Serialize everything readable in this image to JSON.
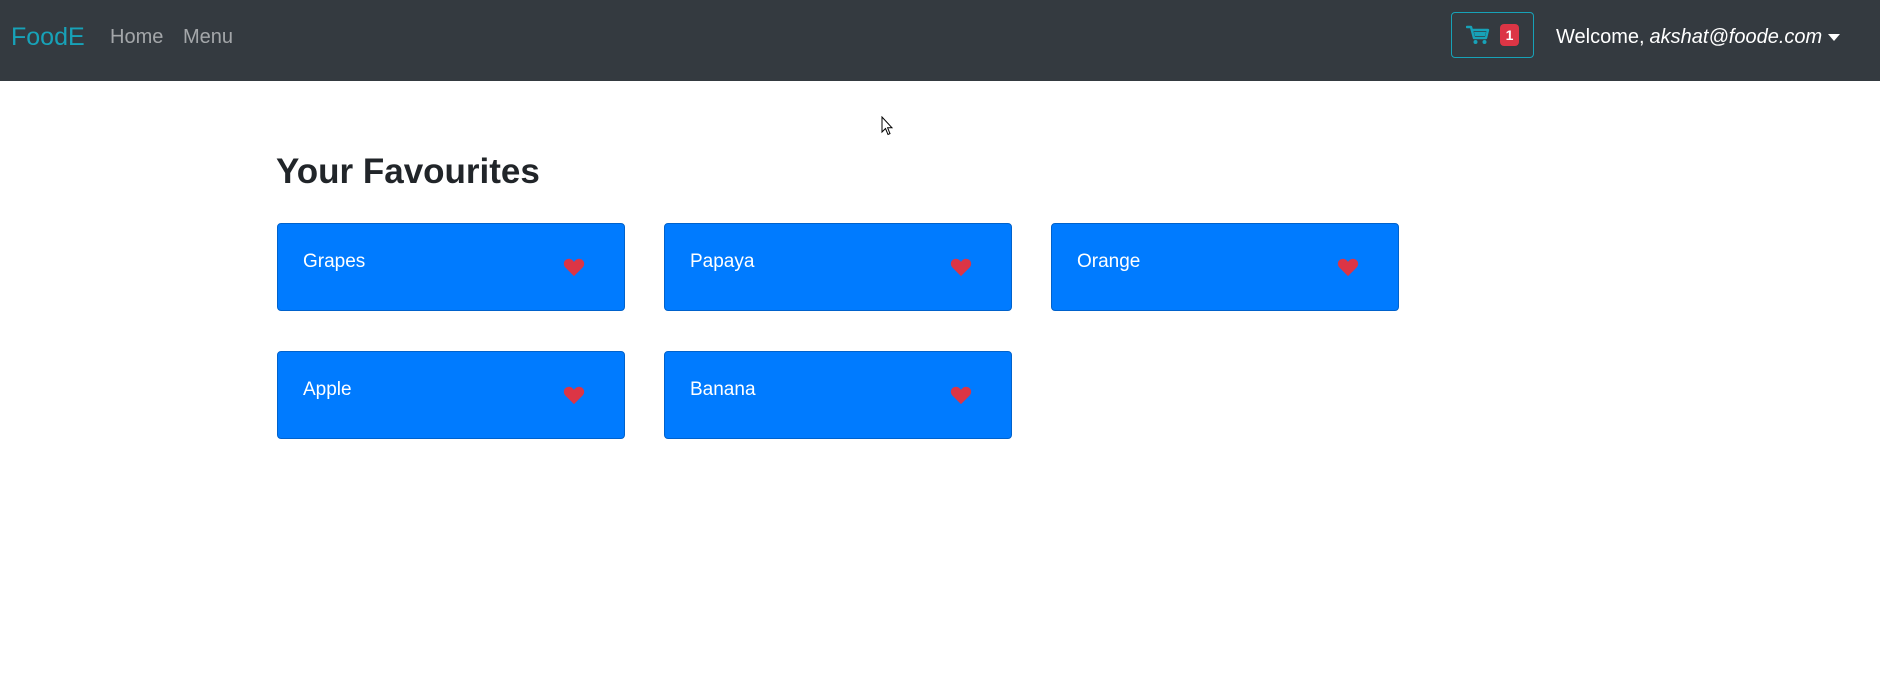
{
  "navbar": {
    "brand": "FoodE",
    "links": [
      "Home",
      "Menu"
    ],
    "cart": {
      "icon": "cart-icon",
      "count": "1"
    },
    "user": {
      "greeting": "Welcome,",
      "email": "akshat@foode.com"
    }
  },
  "main": {
    "title": "Your Favourites",
    "favourites": [
      {
        "name": "Grapes",
        "icon": "heart-icon"
      },
      {
        "name": "Papaya",
        "icon": "heart-icon"
      },
      {
        "name": "Orange",
        "icon": "heart-icon"
      },
      {
        "name": "Apple",
        "icon": "heart-icon"
      },
      {
        "name": "Banana",
        "icon": "heart-icon"
      }
    ]
  },
  "colors": {
    "navbar_bg": "#343a40",
    "brand": "#17a2b8",
    "card_bg": "#007bff",
    "heart": "#dc3545",
    "badge": "#dc3545"
  }
}
